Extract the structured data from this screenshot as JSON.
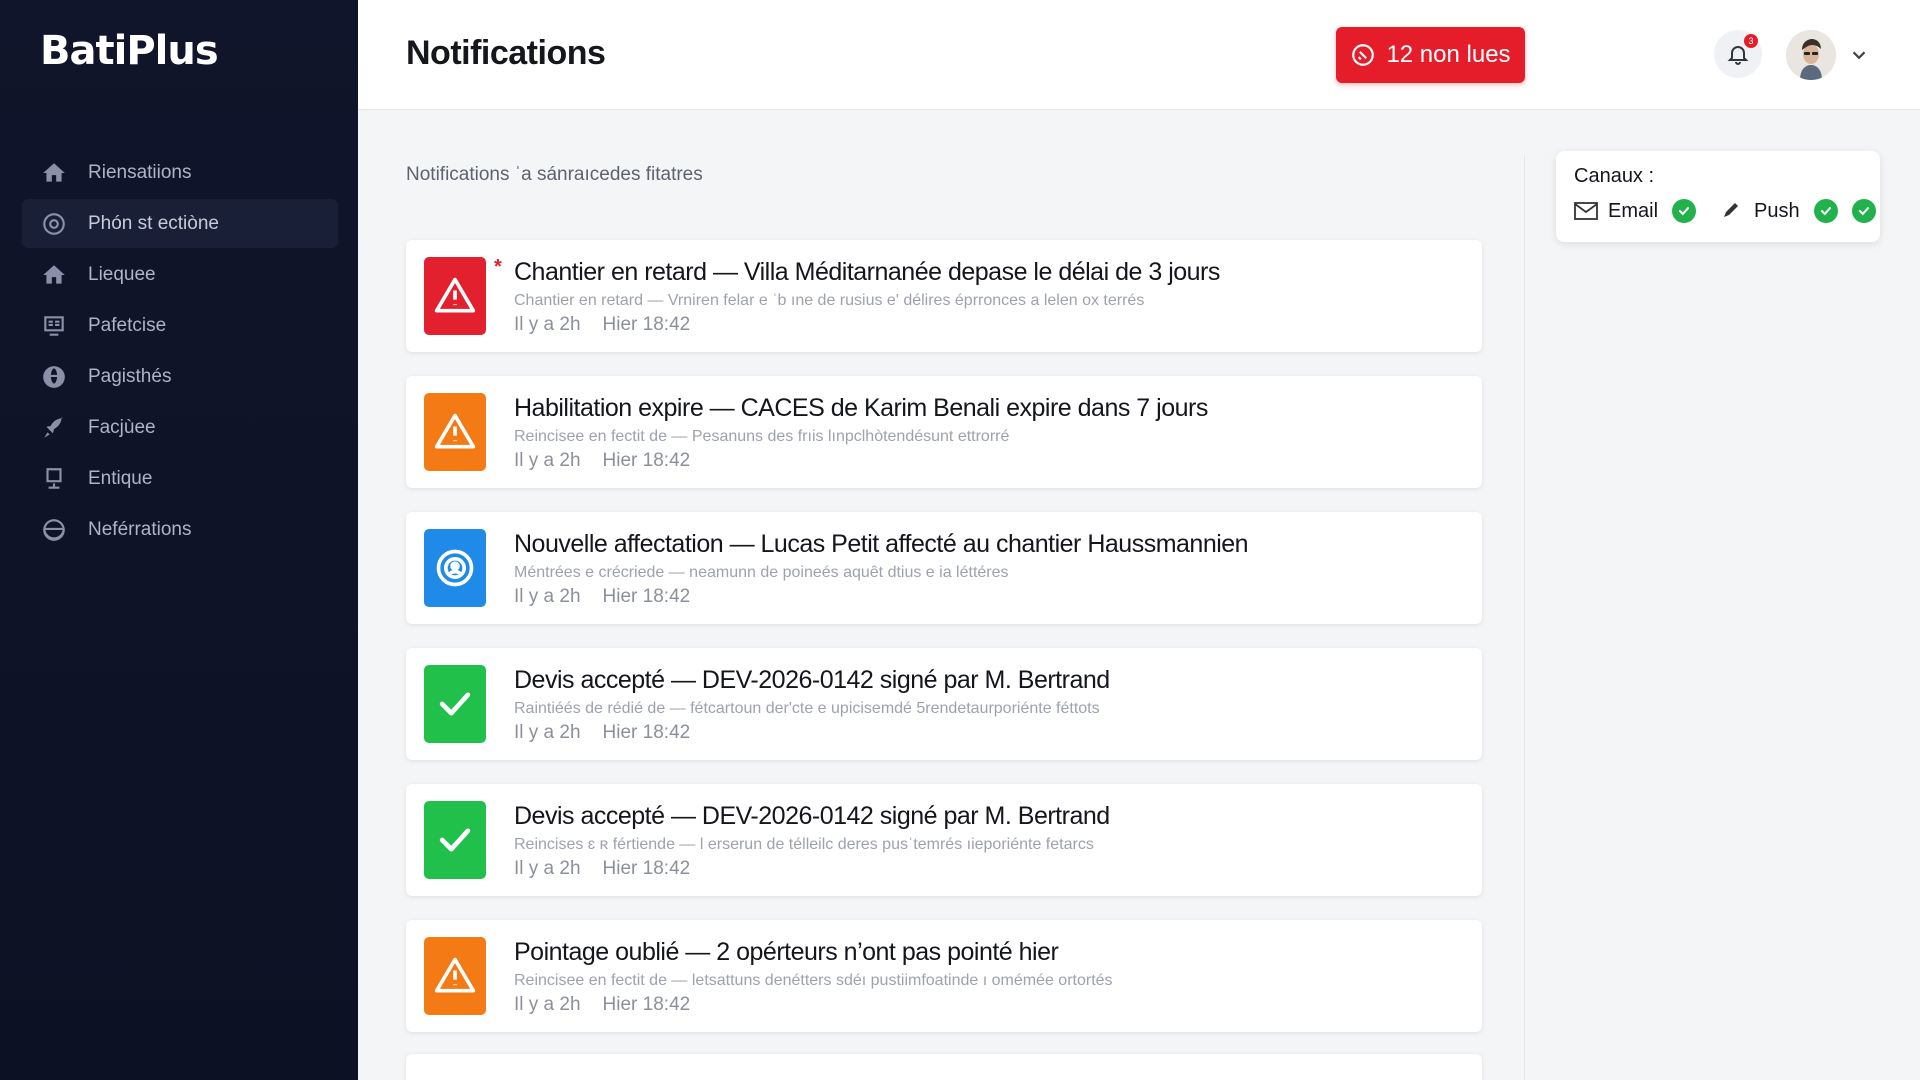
{
  "app": {
    "brand": "BatiPlus"
  },
  "sidebar": {
    "items": [
      {
        "label": "Riensatiions",
        "icon": "home-icon"
      },
      {
        "label": "Phón st ectiòne",
        "icon": "gear-circle-icon",
        "active": true
      },
      {
        "label": "Liequee",
        "icon": "home-icon"
      },
      {
        "label": "Pafetcise",
        "icon": "grid-board-icon"
      },
      {
        "label": "Pagisthés",
        "icon": "globe-person-icon"
      },
      {
        "label": "Facjùee",
        "icon": "rocket-icon"
      },
      {
        "label": "Entique",
        "icon": "easel-icon"
      },
      {
        "label": "Neférrations",
        "icon": "globe-icon"
      }
    ]
  },
  "header": {
    "title": "Notifications",
    "unread_label": "12 non lues",
    "bell_count": "3"
  },
  "main": {
    "filter_text": "Notifications ˈa sánraıcedes fitatres",
    "notifications": [
      {
        "type": "alert",
        "color": "#e3202d",
        "icon": "warning-icon",
        "unread": true,
        "title": "Chantier en retard — Villa Méditarnanée depase le délai de 3 jours",
        "desc": "Chantier en retard — Vrniren felar e ˈb ıne de rusius e' délires éprronces a lelen ox terrés",
        "ago": "Il y a 2h",
        "time": "Hier 18:42"
      },
      {
        "type": "warning",
        "color": "#f37a14",
        "icon": "warning-icon",
        "unread": false,
        "title": "Habilitation expire — CACES de Karim Benali expire dans 7 jours",
        "desc": "Reincisee en fectit de — Pesanuns des frıis lınpclhòtendésunt ettrorré",
        "ago": "Il y a 2h",
        "time": "Hier 18:42"
      },
      {
        "type": "info",
        "color": "#1f8ae8",
        "icon": "assignment-icon",
        "unread": false,
        "title": "Nouvelle affectation — Lucas Petit affecté au chantier Haussmannien",
        "desc": "Méntrées e crécriede — neamunn de poineés aquêt dtius e ia léttéres",
        "ago": "Il y a 2h",
        "time": "Hier 18:42"
      },
      {
        "type": "success",
        "color": "#21c04a",
        "icon": "check-icon",
        "unread": false,
        "title": "Devis accepté — DEV-2026-0142 signé par M. Bertrand",
        "desc": "Raintiéés de rédié de — fétcartoun der'cte e upicisemdé 5rendetaurporiénte féttots",
        "ago": "Il y a 2h",
        "time": "Hier 18:42"
      },
      {
        "type": "success",
        "color": "#21c04a",
        "icon": "check-icon",
        "unread": false,
        "title": "Devis accepté — DEV-2026-0142 signé par M. Bertrand",
        "desc": "Reincises ɛ ʀ fértiende — l erserun de télleilc deres pusˈtemrés ıieporiénte fetarcs",
        "ago": "Il y a 2h",
        "time": "Hier 18:42"
      },
      {
        "type": "warning",
        "color": "#f37a14",
        "icon": "warning-icon",
        "unread": false,
        "title": "Pointage oublié — 2 opérteurs n’ont pas pointé hier",
        "desc": "Reincisee en fectit de — letsattuns denétters sdéı pustiimfoatinde ı omémée ortortés",
        "ago": "Il y a 2h",
        "time": "Hier 18:42"
      }
    ]
  },
  "channels": {
    "title": "Canaux :",
    "email_label": "Email",
    "push_label": "Push"
  }
}
